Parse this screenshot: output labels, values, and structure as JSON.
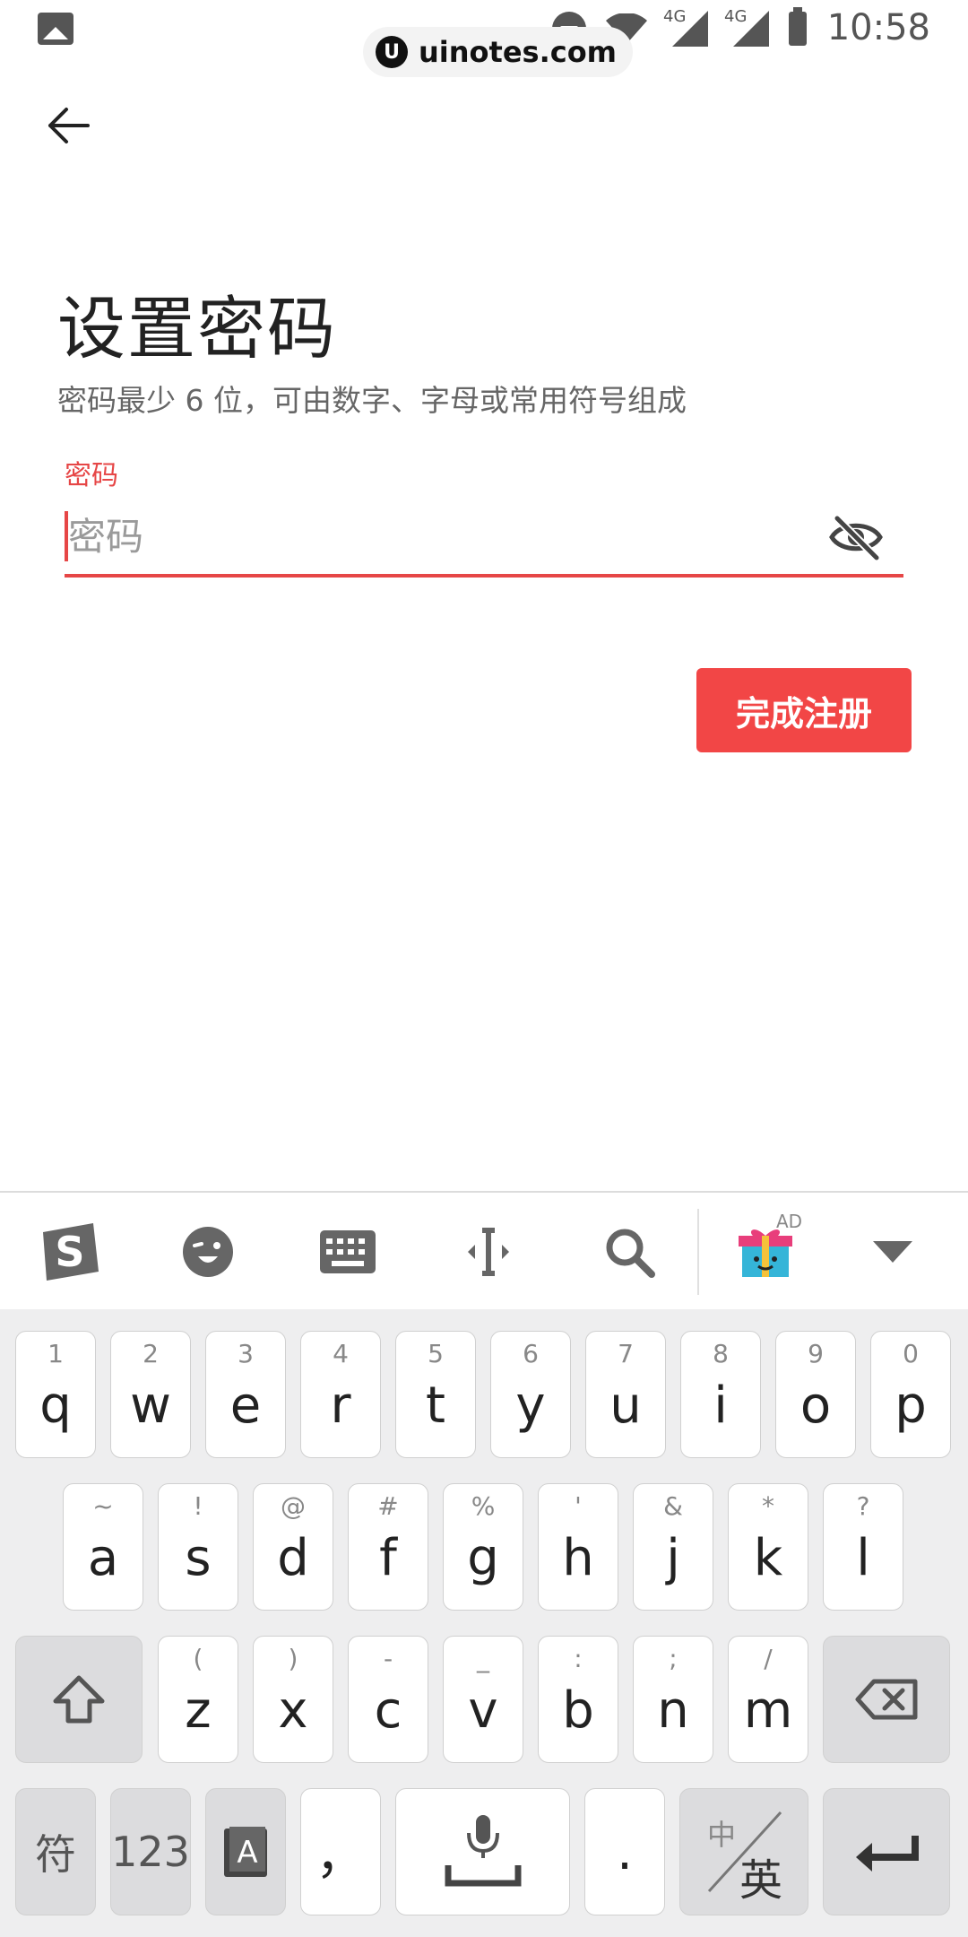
{
  "status_bar": {
    "time": "10:58",
    "network_label_1": "4G",
    "network_label_2": "4G",
    "watermark": "uinotes.com",
    "watermark_logo": "U"
  },
  "screen": {
    "title": "设置密码",
    "subtitle": "密码最少 6 位，可由数字、字母或常用符号组成",
    "field_label": "密码",
    "password_placeholder": "密码",
    "password_value": "",
    "submit_label": "完成注册"
  },
  "colors": {
    "accent": "#f24646",
    "label_red": "#e64646"
  },
  "keyboard_toolbar": {
    "icons": [
      "sogou-logo-icon",
      "emoji-icon",
      "keyboard-icon",
      "cursor-move-icon",
      "search-icon",
      "gift-ad-icon",
      "collapse-icon"
    ],
    "ad_badge": "AD"
  },
  "keyboard": {
    "row1": [
      {
        "pri": "q",
        "sec": "1"
      },
      {
        "pri": "w",
        "sec": "2"
      },
      {
        "pri": "e",
        "sec": "3"
      },
      {
        "pri": "r",
        "sec": "4"
      },
      {
        "pri": "t",
        "sec": "5"
      },
      {
        "pri": "y",
        "sec": "6"
      },
      {
        "pri": "u",
        "sec": "7"
      },
      {
        "pri": "i",
        "sec": "8"
      },
      {
        "pri": "o",
        "sec": "9"
      },
      {
        "pri": "p",
        "sec": "0"
      }
    ],
    "row2": [
      {
        "pri": "a",
        "sec": "~"
      },
      {
        "pri": "s",
        "sec": "!"
      },
      {
        "pri": "d",
        "sec": "@"
      },
      {
        "pri": "f",
        "sec": "#"
      },
      {
        "pri": "g",
        "sec": "%"
      },
      {
        "pri": "h",
        "sec": "'"
      },
      {
        "pri": "j",
        "sec": "&"
      },
      {
        "pri": "k",
        "sec": "*"
      },
      {
        "pri": "l",
        "sec": "?"
      }
    ],
    "row3": [
      {
        "pri": "z",
        "sec": "("
      },
      {
        "pri": "x",
        "sec": ")"
      },
      {
        "pri": "c",
        "sec": "-"
      },
      {
        "pri": "v",
        "sec": "_"
      },
      {
        "pri": "b",
        "sec": ":"
      },
      {
        "pri": "n",
        "sec": ";"
      },
      {
        "pri": "m",
        "sec": "/"
      }
    ],
    "symbols_key": "符",
    "numbers_key": "123",
    "comma_key": "，",
    "period_key": ".",
    "lang_key_top": "中",
    "lang_key_bottom": "英",
    "dict_key_letter": "A"
  }
}
